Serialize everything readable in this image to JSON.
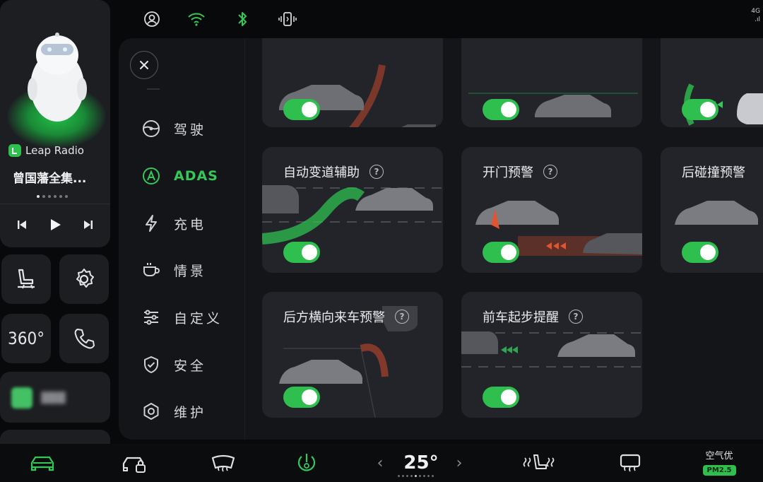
{
  "status_bar": {
    "icons": [
      "account-icon",
      "wifi-icon",
      "bluetooth-icon",
      "phone-vibrate-icon"
    ],
    "right_top": "4G",
    "right_bottom": ".ıl"
  },
  "media": {
    "app_name": "Leap Radio",
    "track_title": "曾国藩全集...",
    "page_dots": 6,
    "active_dot": 0,
    "controls": [
      "previous-icon",
      "play-icon",
      "next-icon"
    ]
  },
  "quick_buttons": [
    {
      "name": "seat-icon"
    },
    {
      "name": "settings-gear-icon"
    },
    {
      "name": "camera-360-button",
      "label": "360°"
    },
    {
      "name": "phone-icon"
    }
  ],
  "nav": {
    "items": [
      {
        "label": "驾驶",
        "icon": "steering-wheel-icon",
        "active": false
      },
      {
        "label": "ADAS",
        "icon": "adas-icon",
        "active": true
      },
      {
        "label": "充电",
        "icon": "lightning-icon",
        "active": false
      },
      {
        "label": "情景",
        "icon": "coffee-cup-icon",
        "active": false
      },
      {
        "label": "自定义",
        "icon": "sliders-icon",
        "active": false
      },
      {
        "label": "安全",
        "icon": "shield-check-icon",
        "active": false
      },
      {
        "label": "维护",
        "icon": "hexagon-nut-icon",
        "active": false
      }
    ]
  },
  "features": [
    {
      "title": "",
      "enabled": true
    },
    {
      "title": "",
      "enabled": true
    },
    {
      "title": "",
      "enabled": true
    },
    {
      "title": "自动变道辅助",
      "enabled": true
    },
    {
      "title": "开门预警",
      "enabled": true
    },
    {
      "title": "后碰撞预警",
      "enabled": true
    },
    {
      "title": "后方横向来车预警",
      "enabled": true
    },
    {
      "title": "前车起步提醒",
      "enabled": true
    }
  ],
  "help_glyph": "?",
  "climate": {
    "temperature": "25°",
    "temp_level_dots": 9,
    "temp_active_dot": 4,
    "air_quality_label": "空气优",
    "pm_label": "PM2.5"
  },
  "bottom_bar": {
    "icons": [
      "car-icon",
      "car-lock-icon",
      "front-defrost-icon",
      "fan-power-icon",
      "temp-decrease-chevron",
      "temp-increase-chevron",
      "seat-heat-icon",
      "rear-defrost-icon"
    ]
  },
  "colors": {
    "accent_green": "#2fbf4f",
    "warning_red": "#e0542f",
    "panel_bg": "#141518",
    "card_bg": "#222429"
  }
}
